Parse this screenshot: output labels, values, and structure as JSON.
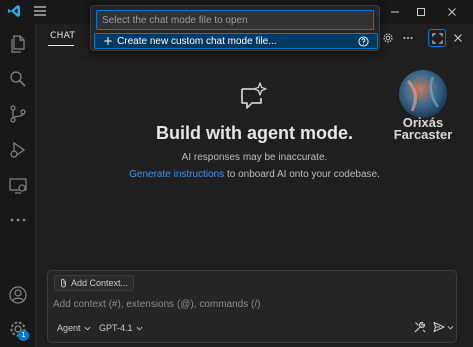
{
  "colors": {
    "accent": "#0078d4",
    "link": "#3794ff",
    "logo_blue": "#23a9f2",
    "badge": "#0078d4"
  },
  "titlebar": {
    "icons": [
      "vscode-logo-icon",
      "menu-icon",
      "minimize-icon",
      "maximize-icon",
      "close-icon"
    ]
  },
  "activitybar": {
    "items": [
      {
        "icon": "explorer-icon"
      },
      {
        "icon": "search-icon"
      },
      {
        "icon": "source-control-icon"
      },
      {
        "icon": "run-debug-icon"
      },
      {
        "icon": "remote-explorer-icon"
      },
      {
        "icon": "more-icon"
      }
    ],
    "bottom": [
      {
        "icon": "account-icon"
      },
      {
        "icon": "settings-gear-icon",
        "badge": "1"
      }
    ]
  },
  "panel": {
    "tab_label": "CHAT",
    "actions": [
      "settings-gear-icon",
      "more-icon",
      "maximize-panel-icon",
      "close-icon"
    ]
  },
  "quickpick": {
    "placeholder": "Select the chat mode file to open",
    "items": [
      {
        "label": "Create new custom chat mode file...",
        "icon": "plus-icon",
        "help_icon": "question-icon"
      }
    ]
  },
  "watermark": {
    "line1": "Orixás",
    "line2": "Farcaster"
  },
  "welcome": {
    "icon": "chat-sparkle-icon",
    "title": "Build with agent mode.",
    "subtitle": "AI responses may be inaccurate.",
    "link_text": "Generate instructions",
    "link_suffix": " to onboard AI onto your codebase."
  },
  "chat_input": {
    "add_context_label": "Add Context...",
    "placeholder": "Add context (#), extensions (@), commands (/)",
    "mode_label": "Agent",
    "model_label": "GPT-4.1",
    "tools_icon": "tools-icon",
    "send_icon": "send-icon"
  }
}
